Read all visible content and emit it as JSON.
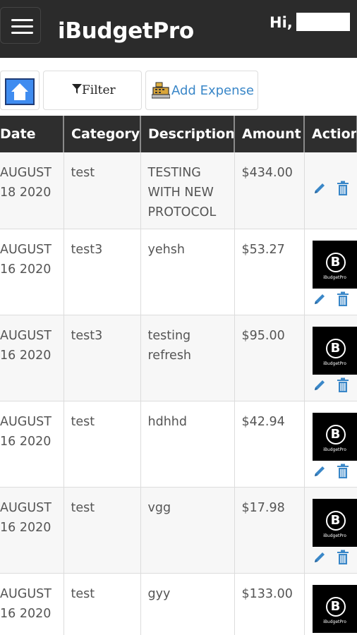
{
  "header": {
    "brand": "iBudgetPro",
    "greeting": "Hi,"
  },
  "toolbar": {
    "filter_label": "Filter",
    "add_expense_label": "Add Expense"
  },
  "table": {
    "columns": [
      "Date",
      "Category",
      "Description",
      "Amount",
      "Action"
    ],
    "rows": [
      {
        "date": "AUGUST 18 2020",
        "category": "test",
        "description": "TESTING WITH NEW PROTOCOL",
        "amount": "$434.00",
        "has_receipt": false
      },
      {
        "date": "AUGUST 16 2020",
        "category": "test3",
        "description": "yehsh",
        "amount": "$53.27",
        "has_receipt": true
      },
      {
        "date": "AUGUST 16 2020",
        "category": "test3",
        "description": "testing refresh",
        "amount": "$95.00",
        "has_receipt": true
      },
      {
        "date": "AUGUST 16 2020",
        "category": "test",
        "description": "hdhhd",
        "amount": "$42.94",
        "has_receipt": true
      },
      {
        "date": "AUGUST 16 2020",
        "category": "test",
        "description": "vgg",
        "amount": "$17.98",
        "has_receipt": true
      },
      {
        "date": "AUGUST 16 2020",
        "category": "test",
        "description": "gyy",
        "amount": "$133.00",
        "has_receipt": true
      }
    ]
  },
  "receipt_logo": {
    "letter": "B",
    "caption": "iBudgetPro"
  },
  "icons": {
    "menu": "menu-icon",
    "home": "home-icon",
    "filter": "filter-icon",
    "add_expense": "cash-register-icon",
    "edit": "pencil-icon",
    "delete": "trash-icon"
  },
  "colors": {
    "header_bg": "#2b2b2b",
    "link": "#3a87c8",
    "row_alt": "#f7f7f7"
  }
}
